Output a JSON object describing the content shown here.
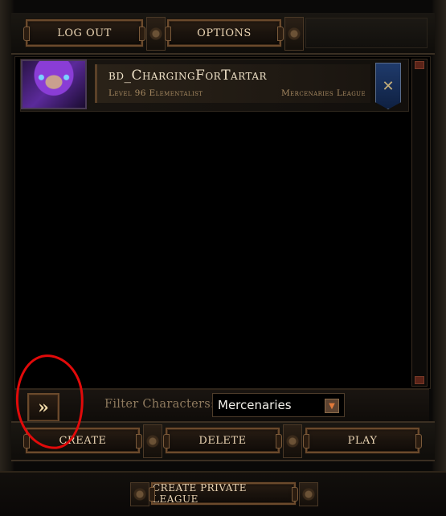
{
  "top_bar": {
    "logout_label": "Log Out",
    "options_label": "Options"
  },
  "character": {
    "name": "bd_ChargingForTartar",
    "level_class": "Level 96 Elementalist",
    "league": "Mercenaries League",
    "banner_icon": "league-banner-icon"
  },
  "filter": {
    "label": "Filter Characters:",
    "selected": "Mercenaries",
    "expand_symbol": "»"
  },
  "bottom_bar": {
    "create_label": "Create",
    "delete_label": "Delete",
    "play_label": "Play"
  },
  "private_league": {
    "label": "Create Private League"
  },
  "colors": {
    "annotation_circle": "#e10a0a",
    "button_text": "#e9d3b2",
    "accent_gold": "#a78a62"
  }
}
